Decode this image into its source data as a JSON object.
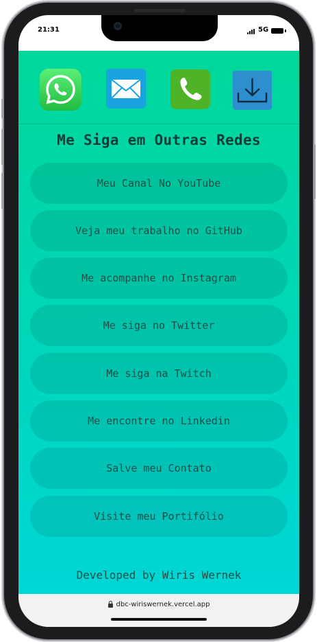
{
  "status_bar": {
    "time": "21:31",
    "network": "5G",
    "signal_icon": "cellular-signal-icon",
    "battery_icon": "battery-icon"
  },
  "contact_icons": [
    {
      "name": "whatsapp-icon",
      "color": "#25d366"
    },
    {
      "name": "mail-icon",
      "color": "#1aa6e0"
    },
    {
      "name": "phone-icon",
      "color": "#53b928"
    },
    {
      "name": "download-icon",
      "color": "#2e8fcf"
    }
  ],
  "heading": "Me Siga em Outras Redes",
  "links": [
    "Meu Canal No YouTube",
    "Veja meu trabalho no GitHub",
    "Me acompanhe no Instagram",
    "Me siga no Twitter",
    "Me siga na Twitch",
    "Me encontre no Linkedin",
    "Salve meu Contato",
    "Visite meu Portifólio"
  ],
  "footer": "Developed by Wiris Wernek",
  "browser": {
    "url": "dbc-wiriswernek.vercel.app",
    "lock_icon": "lock-icon"
  },
  "colors": {
    "gradient_top": "#00d79a",
    "gradient_bottom": "#00d7d6",
    "text": "#1e4e48"
  }
}
